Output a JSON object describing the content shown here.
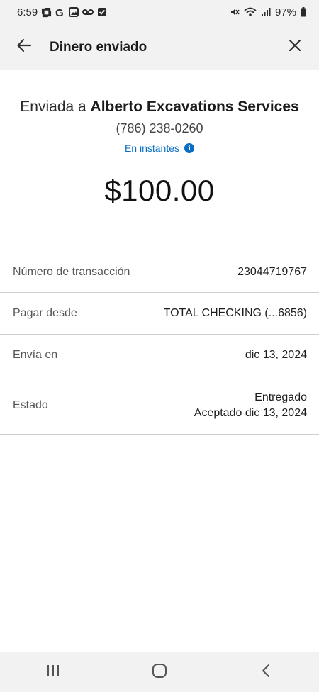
{
  "status_bar": {
    "time": "6:59",
    "battery": "97%",
    "icons": [
      "chase-icon",
      "google-icon",
      "gallery-icon",
      "voicemail-icon",
      "checkbox-icon",
      "mute-icon",
      "wifi-icon",
      "signal-icon",
      "battery-icon"
    ]
  },
  "header": {
    "title": "Dinero enviado",
    "back_icon": "arrow-left-icon",
    "close_icon": "close-icon"
  },
  "summary": {
    "sent_to_prefix": "Enviada a",
    "recipient_name": "Alberto Excavations Services",
    "phone": "(786) 238-0260",
    "speed": "En instantes",
    "amount": "$100.00"
  },
  "details": [
    {
      "label": "Número de transacción",
      "value": "23044719767"
    },
    {
      "label": "Pagar desde",
      "value": "TOTAL CHECKING (...6856)"
    },
    {
      "label": "Envía en",
      "value": "dic 13, 2024"
    },
    {
      "label": "Estado",
      "value": "Entregado",
      "value_line2": "Aceptado dic 13, 2024"
    }
  ],
  "colors": {
    "accent": "#0a6fc2",
    "bar_background": "#f2f2f2",
    "divider": "#cfcfcf"
  }
}
